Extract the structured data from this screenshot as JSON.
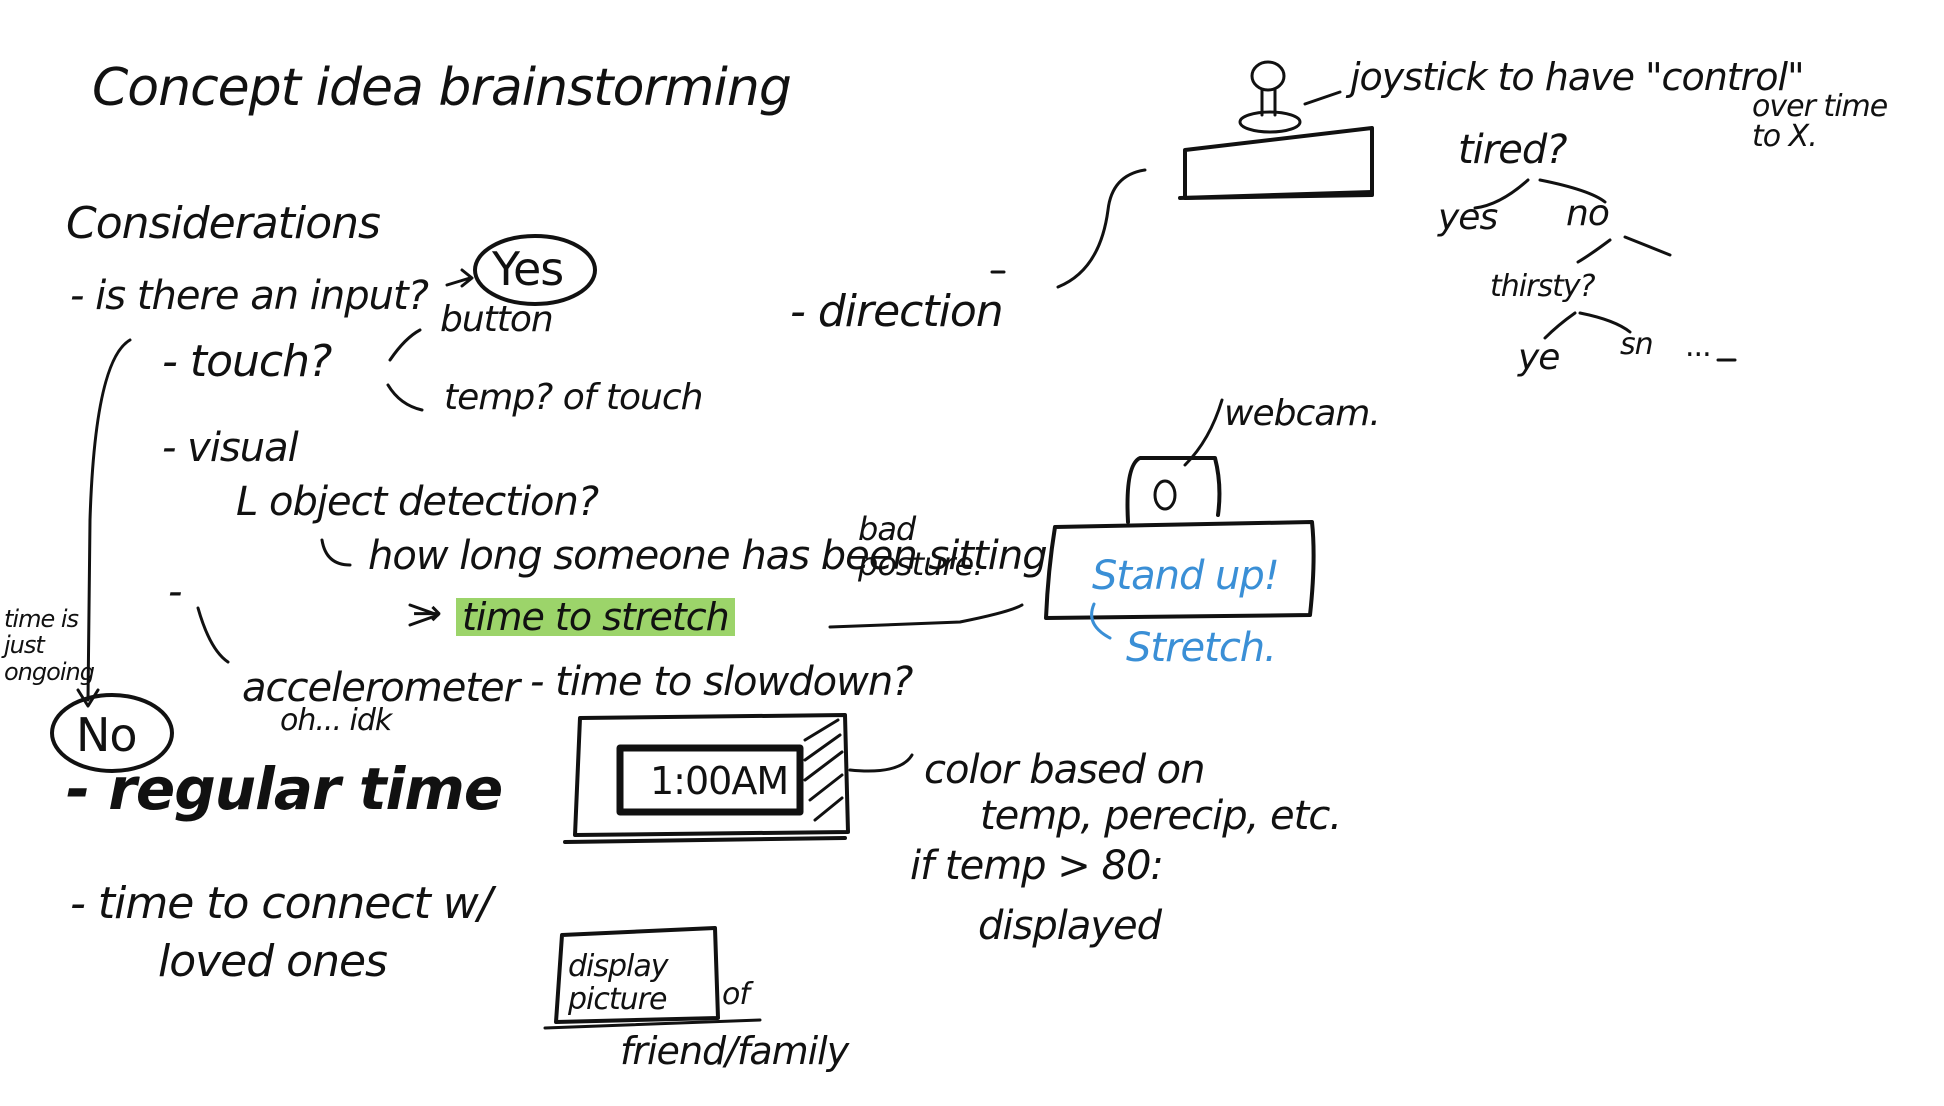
{
  "sheet": {
    "title": "Concept idea brainstorming",
    "considerations": "Considerations",
    "input_question": "- is there an input?",
    "yes": "Yes",
    "no": "No",
    "button": "button",
    "touch": "- touch?",
    "temp_touch": "temp? of touch",
    "visual": "- visual",
    "object_detection": "L object detection?",
    "how_long": "how long someone has been sitting",
    "bad_posture": "bad posture.",
    "stretch_arrow": "→",
    "time_to_stretch": "time to stretch",
    "dash": "-",
    "accelerometer": "accelerometer",
    "oh_idk": "oh... idk",
    "time_to_slowdown": "- time to slowdown?",
    "time_note": "time is just ongoing",
    "regular_time": "- regular time",
    "connect": "- time to connect w/",
    "loved_ones": "loved ones",
    "display_picture": "display picture",
    "of": "of",
    "friend_family": "friend/family",
    "clock_display": "1:00AM",
    "color_based": "color based on",
    "temp_precip": "temp, perecip, etc.",
    "if_temp": "if temp > 80:",
    "displayed": "displayed",
    "webcam": "webcam.",
    "stand_up": "Stand up!",
    "stretch": "Stretch.",
    "direction": "- direction",
    "joystick": "joystick to have \"control\"",
    "over_time": "over time to X.",
    "tired": "tired?",
    "yes_branch": "yes",
    "no_branch": "no",
    "thirsty": "thirsty?",
    "ye": "ye",
    "sn": "sn",
    "ellipsis": "..."
  },
  "colors": {
    "ink": "#111111",
    "blue_ink": "#3a8fd6",
    "highlight": "#9cd46a"
  }
}
